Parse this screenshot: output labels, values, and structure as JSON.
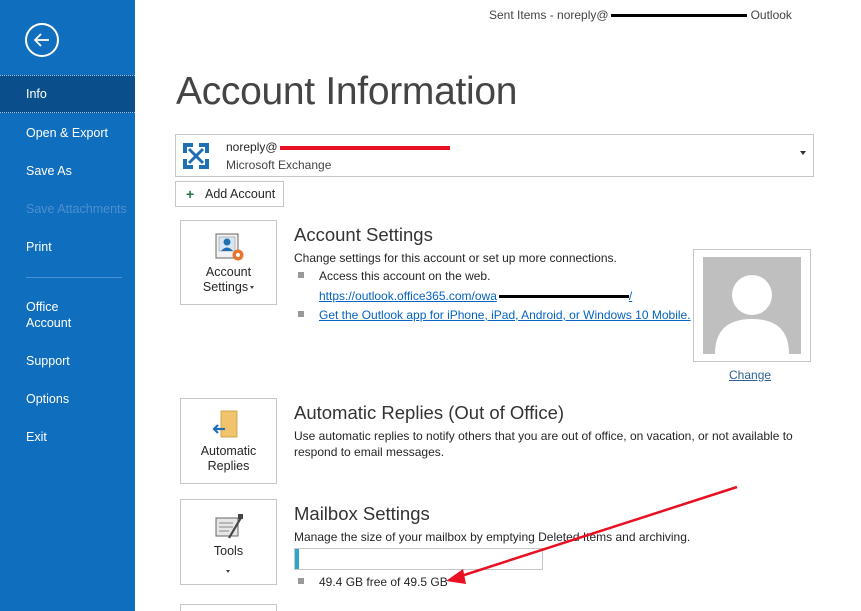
{
  "window": {
    "title_prefix": "Sent Items - noreply@",
    "title_suffix": "Outlook"
  },
  "sidebar": {
    "items": [
      {
        "label": "Info",
        "active": true
      },
      {
        "label": "Open & Export"
      },
      {
        "label": "Save As"
      },
      {
        "label": "Save Attachments",
        "disabled": true
      },
      {
        "label": "Print"
      },
      {
        "label": "Office\nAccount"
      },
      {
        "label": "Support"
      },
      {
        "label": "Options"
      },
      {
        "label": "Exit"
      }
    ]
  },
  "page": {
    "title": "Account Information"
  },
  "account": {
    "email_prefix": "noreply@",
    "type": "Microsoft Exchange"
  },
  "add_account": {
    "label": "Add Account"
  },
  "account_settings": {
    "tile_label": "Account\nSettings",
    "title": "Account Settings",
    "desc": "Change settings for this account or set up more connections.",
    "bullet1": "Access this account on the web.",
    "web_link": "https://outlook.office365.com/owa",
    "link_suffix": "/",
    "bullet2_link": "Get the Outlook app for iPhone, iPad, Android, or Windows 10 Mobile."
  },
  "profile": {
    "change_label": "Change"
  },
  "auto_replies": {
    "tile_label": "Automatic\nReplies",
    "title": "Automatic Replies (Out of Office)",
    "desc": "Use automatic replies to notify others that you are out of office, on vacation, or not available to respond to email messages."
  },
  "mailbox": {
    "tile_label": "Tools",
    "title": "Mailbox Settings",
    "desc": "Manage the size of your mailbox by emptying Deleted Items and archiving.",
    "usage_fraction": 0.01,
    "usage_text": "49.4 GB free of 49.5 GB"
  },
  "colors": {
    "sidebar": "#106ebe",
    "sidebar_active": "#0a4f8c",
    "link": "#0563c1",
    "progress": "#2aa7c9",
    "annotation": "#e81123"
  }
}
